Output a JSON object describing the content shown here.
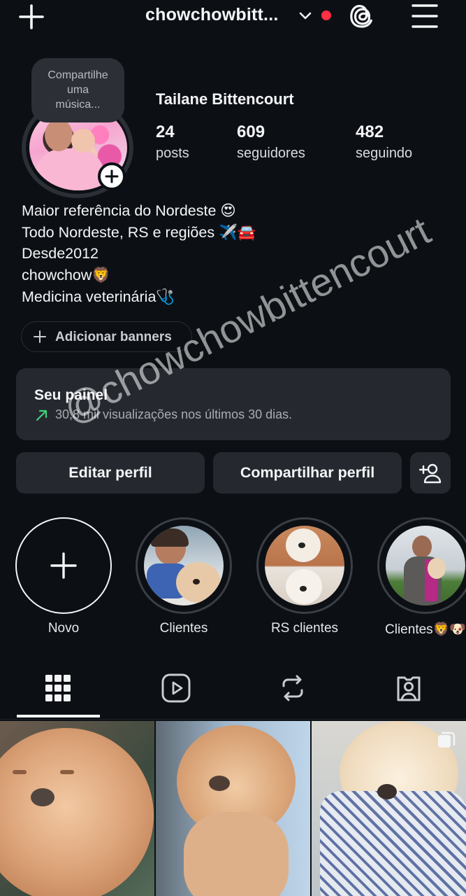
{
  "header": {
    "username": "chowchowbitt...",
    "icons": {
      "create": "plus-icon",
      "accounts": "chevron-down-icon",
      "threads": "threads-icon",
      "menu": "menu-icon"
    },
    "notification_color": "#ff2f45"
  },
  "profile": {
    "note": [
      "Compartilhe",
      "uma",
      "música..."
    ],
    "full_name": "Tailane Bittencourt",
    "stats": [
      {
        "value": "24",
        "label": "posts"
      },
      {
        "value": "609",
        "label": "seguidores"
      },
      {
        "value": "482",
        "label": "seguindo"
      }
    ],
    "bio": [
      "Maior referência do Nordeste 😍",
      "Todo Nordeste, RS e regiões ✈️🚘",
      "Desde2012",
      "chowchow🦁",
      "Medicina veterinária🩺"
    ],
    "banners_label": "Adicionar banners"
  },
  "dashboard": {
    "title": "Seu painel",
    "subtitle": "30,8 mil visualizações nos últimos 30 dias.",
    "trend_color": "#3fd07a"
  },
  "actions": {
    "edit_label": "Editar perfil",
    "share_label": "Compartilhar perfil",
    "add_person_icon": "add-person-icon"
  },
  "highlights": [
    {
      "label": "Novo"
    },
    {
      "label": "Clientes"
    },
    {
      "label": "RS clientes"
    },
    {
      "label": "Clientes🦁🐶"
    }
  ],
  "tabs": [
    {
      "name": "grid",
      "icon": "grid-icon",
      "active": true
    },
    {
      "name": "reels",
      "icon": "reels-icon",
      "active": false
    },
    {
      "name": "reposts",
      "icon": "repost-icon",
      "active": false
    },
    {
      "name": "tagged",
      "icon": "tagged-icon",
      "active": false
    }
  ],
  "watermark": "@chowchowbittencourt"
}
